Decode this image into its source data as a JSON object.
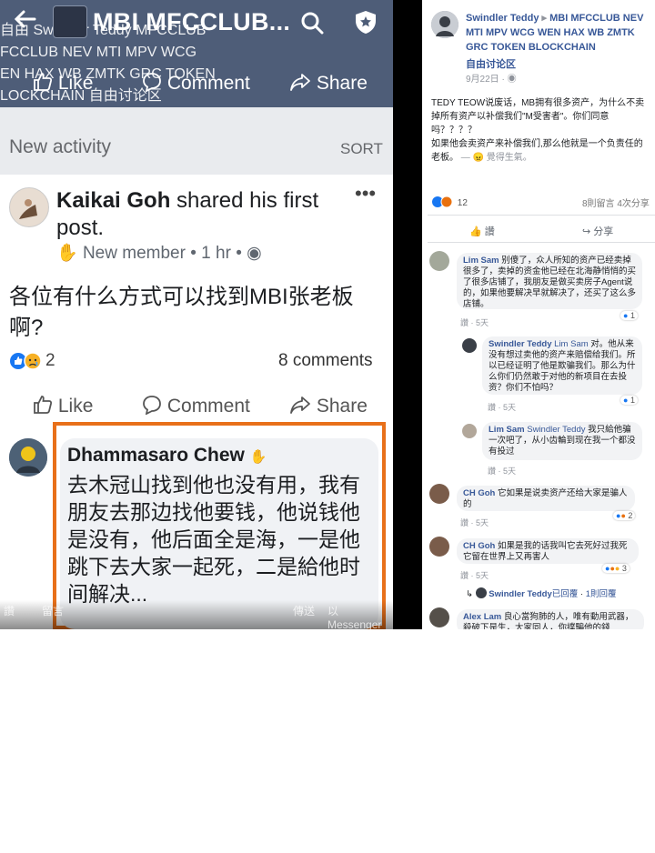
{
  "left": {
    "header": {
      "title": "MBI MFCCLUB...",
      "ghost_lines": [
        "自由 Swindler Teddy MFCCLUB",
        "FCCLUB NEV MTI MPV WCG",
        "EN HAX WB ZMTK GRC TOKEN",
        "LOCKCHAIN 自由讨论区"
      ]
    },
    "top_actions": {
      "like": "Like",
      "comment": "Comment",
      "share": "Share"
    },
    "new_activity": {
      "title": "New activity",
      "sort": "SORT"
    },
    "post": {
      "author": "Kaikai Goh",
      "author_suffix": "shared his first post.",
      "badge": "New member",
      "time": "1 hr",
      "body": "各位有什么方式可以找到MBI张老板啊?",
      "reactions_count": "2",
      "comments_count": "8 comments"
    },
    "actions": {
      "like": "Like",
      "comment": "Comment",
      "share": "Share"
    },
    "comment": {
      "name": "Dhammasaro Chew",
      "text": "去木冠山找到他也没有用，我有朋友去那边找他要钱，他说钱他是没有，他后面全是海，一是他跳下去大家一起死，二是給他时间解决..."
    },
    "bottom_bar": {
      "left": "讚",
      "mid": "留言",
      "right1": "傳送",
      "right2": "以 Messenger 傳送"
    }
  },
  "right": {
    "author": "Swindler Teddy",
    "group": "MBI MFCCLUB NEV MTI MPV WCG WEN HAX WB ZMTK GRC TOKEN BLOCKCHAIN",
    "forum": "自由讨论区",
    "date": "9月22日",
    "body_1": "TEDY TEOW说废话，MB拥有很多资产，为什么不卖掉所有资产以补偿我们\"M受害者\"。你们同意吗？？？？",
    "body_2": "如果他会卖资产来补偿我们,那么他就是一个负责任的老板。",
    "body_feeling": "— 😠 覺得生氣。",
    "reactions_count": "12",
    "stats": "8則留言  4次分享",
    "actions": {
      "like": "讚",
      "share": "分享"
    },
    "comments": [
      {
        "name": "Lim Sam",
        "text": "别傻了，众人所知的资产已经卖掉很多了，卖掉的资金他已经在北海静悄悄的买了很多店铺了，我朋友是做买卖房子Agent说的，如果他要解决早就解决了，还买了这么多店铺。",
        "like": "讚",
        "time": "5天",
        "reacts": "1"
      },
      {
        "name": "Swindler Teddy",
        "mention": "Lim Sam",
        "text": "对。他从来没有想过卖他的资产来赔偿给我们。所以已经证明了他是欺骗我们。那么为什么你们仍然敢于对他的新项目在去投资？你们不怕吗？",
        "like": "讚",
        "time": "5天",
        "reacts": "1"
      },
      {
        "name": "Lim Sam",
        "mention": "Swindler Teddy",
        "text": "我只給他骗一次吧了，从小齿輪到现在我一个都没有投过",
        "like": "讚",
        "time": "5天"
      },
      {
        "name": "CH Goh",
        "text": "它如果是说卖资产还给大家是骗人的",
        "like": "讚",
        "time": "5天",
        "reacts": "2"
      },
      {
        "name": "CH Goh",
        "text": "如果是我的话我叫它去死好过我死它留在世界上又再害人",
        "like": "讚",
        "time": "5天",
        "reacts": "3"
      },
      {
        "name": "Swindler Teddy",
        "suffix": "已回覆",
        "replies": "1則回覆"
      },
      {
        "name": "Alex Lam",
        "text": "良心當狗肺的人，唯有動用武器，殺破下是生，大家同人，你撲騙他的錢..."
      }
    ]
  },
  "colors": {
    "header_bg": "#4e5d78",
    "highlight_border": "#e8701a",
    "fb_blue": "#385898",
    "divider": "#000000"
  }
}
